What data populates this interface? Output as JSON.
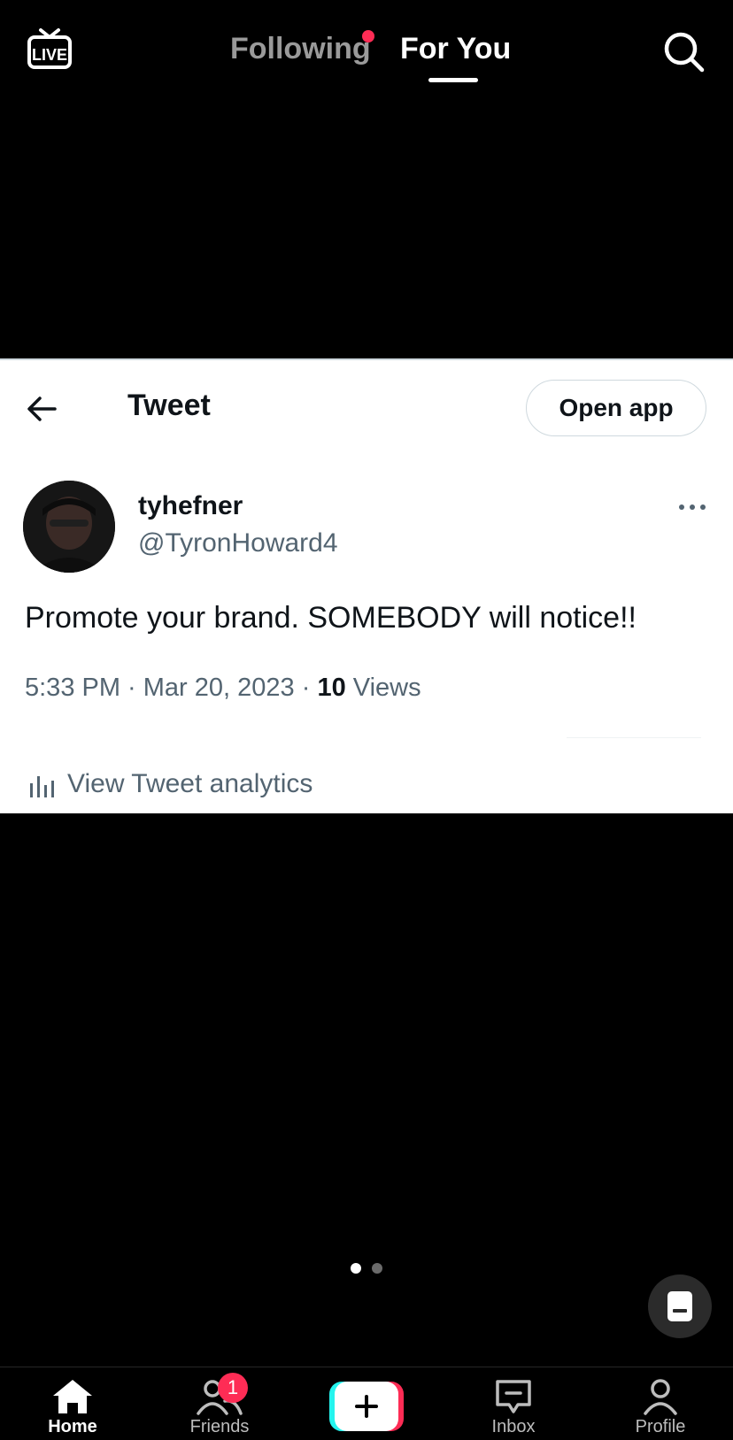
{
  "topbar": {
    "live_label": "LIVE",
    "tab_following": "Following",
    "tab_foryou": "For You",
    "active_tab": "For You"
  },
  "tweet": {
    "header_title": "Tweet",
    "open_app_label": "Open app",
    "display_name": "tyhefner",
    "handle": "@TyronHoward4",
    "text": "Promote your brand. SOMEBODY will notice!!",
    "meta_prefix": "5:33 PM · Mar 20, 2023 · ",
    "views_count": "10",
    "views_label": " Views",
    "analytics_label": "View Tweet analytics"
  },
  "pager": {
    "total": 2,
    "active_index": 0
  },
  "bottom_nav": {
    "items": [
      {
        "label": "Home",
        "icon": "home-icon",
        "active": true
      },
      {
        "label": "Friends",
        "icon": "friends-icon",
        "badge": "1"
      },
      {
        "label": "",
        "icon": "create-plus-icon"
      },
      {
        "label": "Inbox",
        "icon": "inbox-icon"
      },
      {
        "label": "Profile",
        "icon": "profile-icon"
      }
    ]
  },
  "colors": {
    "background": "#000000",
    "accent_red": "#fe2c55",
    "accent_cyan": "#25f4ee",
    "tweet_text": "#0f1419",
    "tweet_secondary": "#536471"
  }
}
